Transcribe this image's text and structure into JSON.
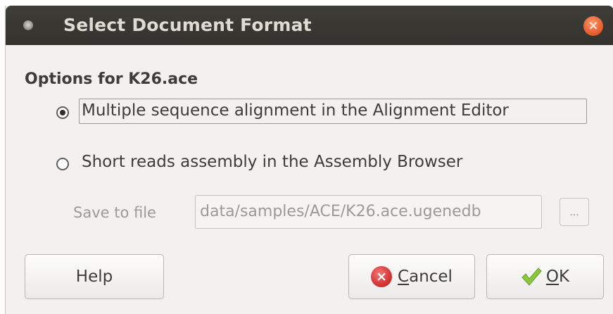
{
  "window": {
    "title": "Select Document Format"
  },
  "options": {
    "group_label": "Options for K26.ace",
    "choices": [
      {
        "label": "Multiple sequence alignment in the Alignment Editor",
        "selected": true
      },
      {
        "label": "Short reads assembly in the Assembly Browser",
        "selected": false
      }
    ]
  },
  "save": {
    "label": "Save to file",
    "value": "data/samples/ACE/K26.ace.ugenedb",
    "browse_label": "..."
  },
  "buttons": {
    "help": "Help",
    "cancel_mnemonic": "C",
    "cancel_rest": "ancel",
    "ok_mnemonic": "O",
    "ok_rest": "K"
  },
  "colors": {
    "titlebar": "#3c3b37",
    "close_button": "#eb6536",
    "cancel_icon": "#d83a3a",
    "ok_check": "#8cc63f"
  }
}
